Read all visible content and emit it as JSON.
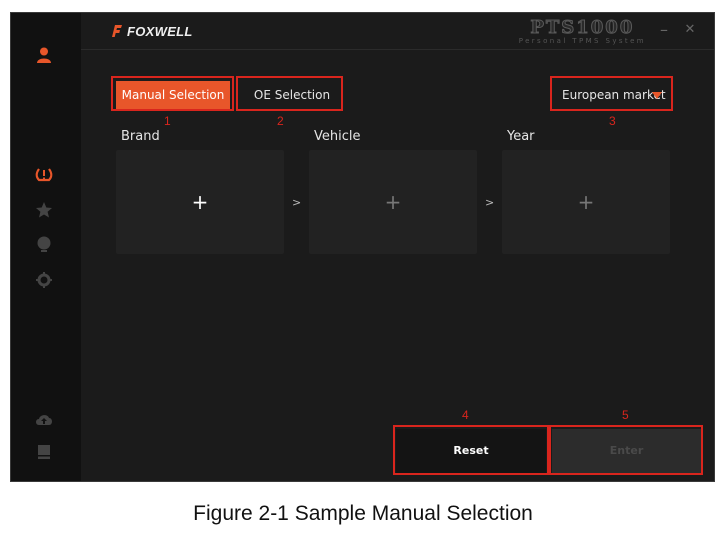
{
  "app": {
    "logo_text": "FOXWELL",
    "product_name": "PTS1000",
    "product_subtitle": "Personal TPMS System",
    "minimize_label": "–",
    "close_label": "✕"
  },
  "tabs": [
    {
      "label": "Manual Selection",
      "active": true
    },
    {
      "label": "OE  Selection",
      "active": false
    }
  ],
  "market_select": {
    "value": "European market"
  },
  "columns": [
    {
      "label": "Brand",
      "placeholder": "+"
    },
    {
      "label": "Vehicle",
      "placeholder": "+"
    },
    {
      "label": "Year",
      "placeholder": "+"
    }
  ],
  "separator": ">",
  "buttons": {
    "reset": "Reset",
    "enter": "Enter"
  },
  "callouts": [
    "1",
    "2",
    "3",
    "4",
    "5"
  ],
  "caption": "Figure 2-1 Sample Manual Selection",
  "colors": {
    "accent": "#e8562a",
    "callout": "#d9251d",
    "background": "#1b1b1b"
  },
  "sidebar_icons": [
    "user-icon",
    "tire-pressure-icon",
    "star-icon",
    "globe-icon",
    "gear-icon",
    "cloud-upload-icon",
    "book-icon"
  ]
}
